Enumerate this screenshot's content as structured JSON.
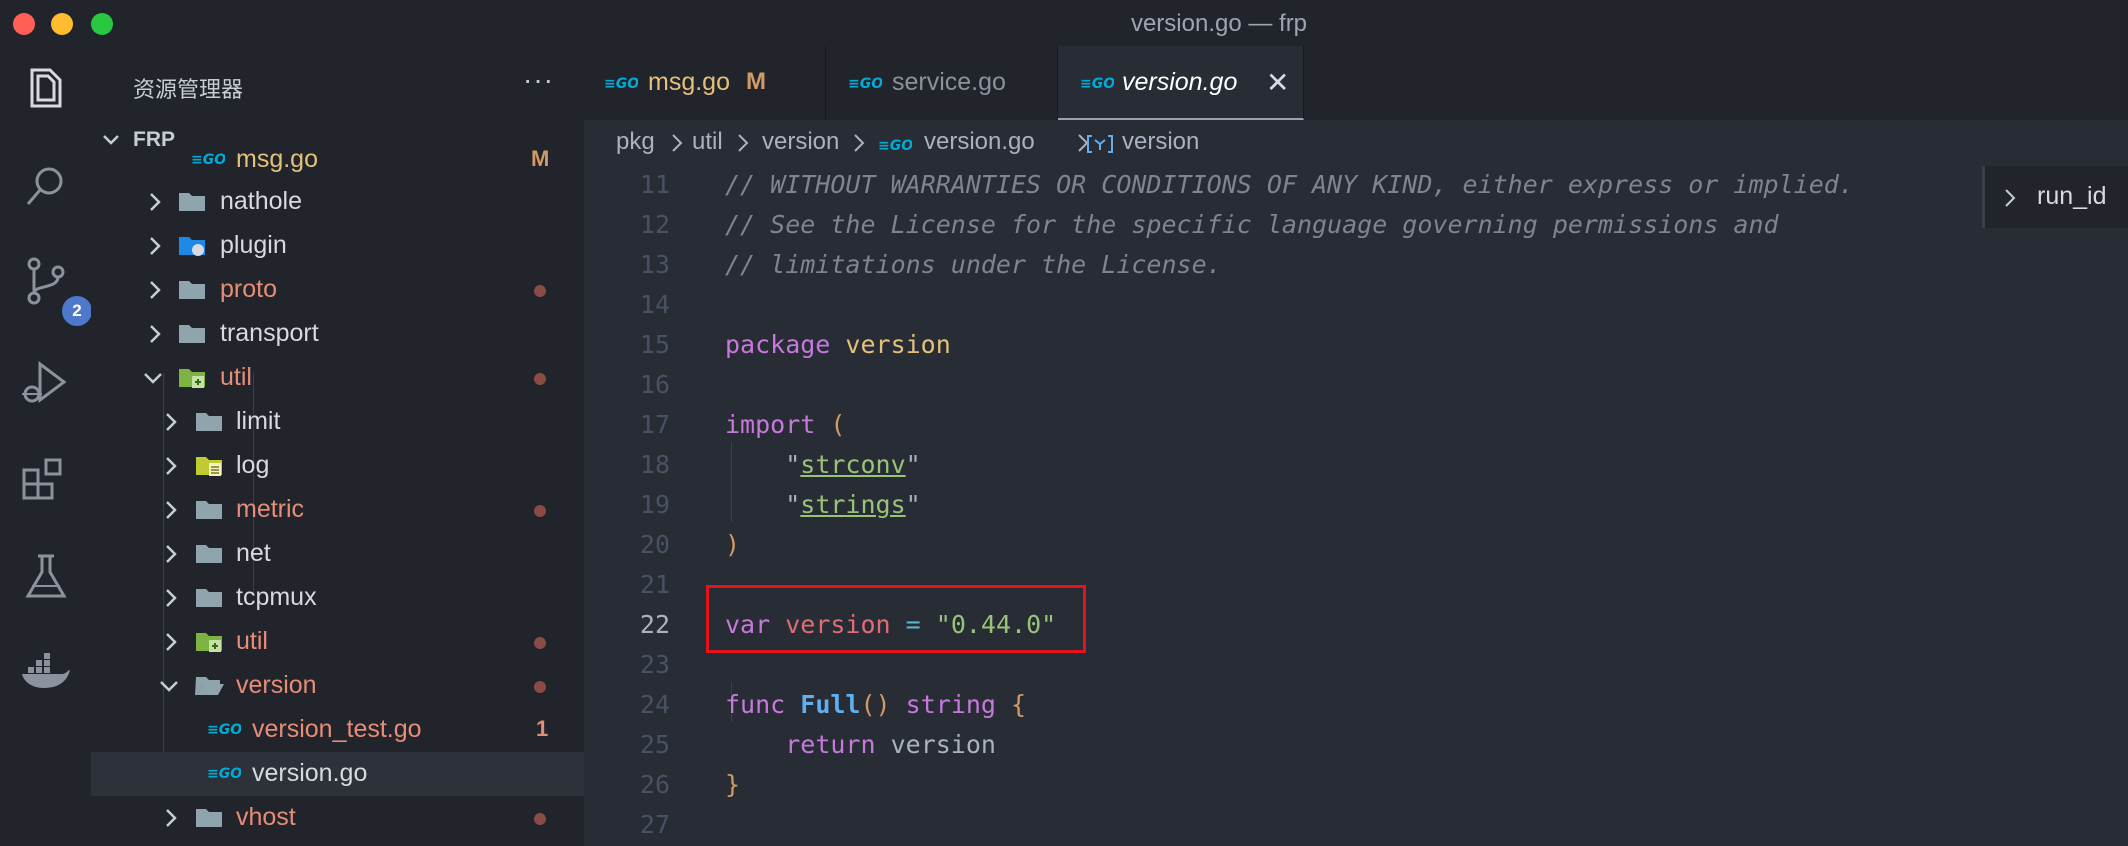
{
  "window": {
    "title": "version.go — frp"
  },
  "activity_bar": {
    "items": [
      {
        "icon": "files-icon"
      },
      {
        "icon": "search-icon"
      },
      {
        "icon": "source-control-icon",
        "badge": "2"
      },
      {
        "icon": "run-debug-icon"
      },
      {
        "icon": "extensions-icon"
      },
      {
        "icon": "testing-icon"
      },
      {
        "icon": "docker-icon"
      }
    ]
  },
  "sidebar": {
    "title": "资源管理器",
    "more": "···",
    "section": "FRP",
    "items": [
      {
        "name": "msg.go",
        "status": "M",
        "kind": "go-file"
      },
      {
        "name": "nathole",
        "kind": "folder"
      },
      {
        "name": "plugin",
        "kind": "plugin-folder"
      },
      {
        "name": "proto",
        "kind": "folder",
        "modified": true
      },
      {
        "name": "transport",
        "kind": "folder"
      },
      {
        "name": "util",
        "kind": "util-folder-open",
        "modified": true
      },
      {
        "name": "limit",
        "kind": "folder"
      },
      {
        "name": "log",
        "kind": "log-folder"
      },
      {
        "name": "metric",
        "kind": "folder",
        "modified": true
      },
      {
        "name": "net",
        "kind": "folder"
      },
      {
        "name": "tcpmux",
        "kind": "folder"
      },
      {
        "name": "util",
        "kind": "util-folder",
        "modified": true
      },
      {
        "name": "version",
        "kind": "folder-open",
        "modified": true
      },
      {
        "name": "version_test.go",
        "status": "1",
        "kind": "go-file"
      },
      {
        "name": "version.go",
        "kind": "go-file",
        "selected": true
      },
      {
        "name": "vhost",
        "kind": "folder",
        "modified": true
      }
    ]
  },
  "tabs": [
    {
      "label": "msg.go",
      "status": "M"
    },
    {
      "label": "service.go"
    },
    {
      "label": "version.go",
      "close": "✕",
      "active": true
    }
  ],
  "breadcrumb": {
    "items": [
      "pkg",
      "util",
      "version",
      "version.go",
      "version"
    ]
  },
  "editor": {
    "lines": [
      {
        "n": "11",
        "text": "// WITHOUT WARRANTIES OR CONDITIONS OF ANY KIND, either express or implied."
      },
      {
        "n": "12",
        "text": "// See the License for the specific language governing permissions and"
      },
      {
        "n": "13",
        "text": "// limitations under the License."
      },
      {
        "n": "14"
      },
      {
        "n": "15",
        "kw": "package",
        "ident": "version"
      },
      {
        "n": "16"
      },
      {
        "n": "17",
        "kw": "import",
        "paren": "("
      },
      {
        "n": "18",
        "q1": "\"",
        "pkg": "strconv",
        "q2": "\""
      },
      {
        "n": "19",
        "q1": "\"",
        "pkg": "strings",
        "q2": "\""
      },
      {
        "n": "20",
        "paren": ")"
      },
      {
        "n": "21"
      },
      {
        "n": "22",
        "kw": "var",
        "ident": "version",
        "op": "=",
        "value": "\"0.44.0\""
      },
      {
        "n": "23"
      },
      {
        "n": "24",
        "kw": "func",
        "fn": "Full",
        "parens": "()",
        "type": "string",
        "brace": "{"
      },
      {
        "n": "25",
        "kw": "return",
        "ident": "version"
      },
      {
        "n": "26",
        "brace": "}"
      },
      {
        "n": "27"
      }
    ]
  },
  "sticky": {
    "label": "run_id"
  },
  "colors": {
    "highlight_box": "#e5141b",
    "modified_text": "#e78c77",
    "badge": "#4d78cc"
  }
}
